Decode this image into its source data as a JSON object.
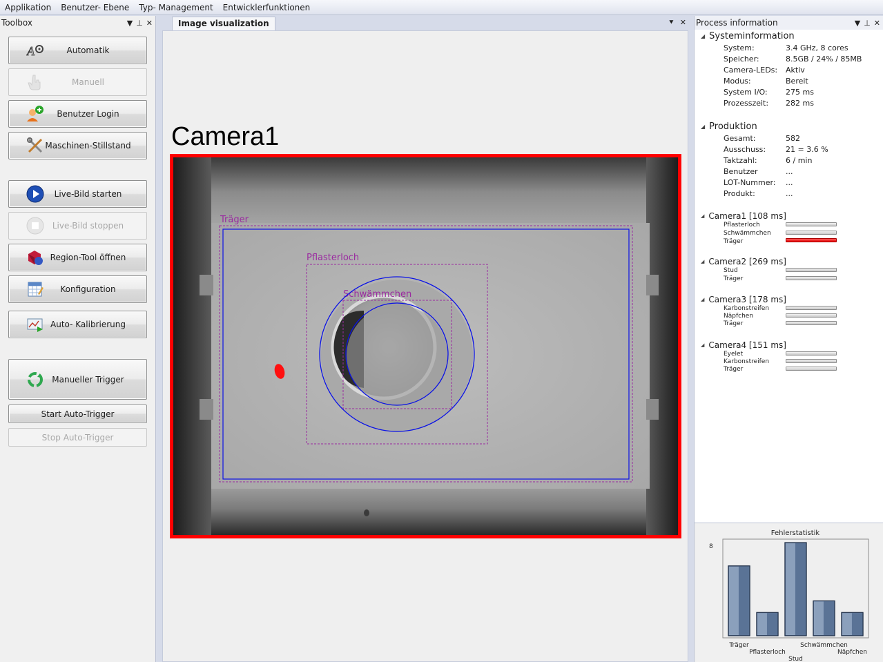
{
  "menu": [
    "Applikation",
    "Benutzer- Ebene",
    "Typ- Management",
    "Entwicklerfunktionen"
  ],
  "toolbox": {
    "title": "Toolbox",
    "buttons": [
      {
        "label": "Automatik",
        "icon": "automatic-icon",
        "enabled": true
      },
      {
        "label": "Manuell",
        "icon": "hand-icon",
        "enabled": false
      },
      {
        "label": "Benutzer Login",
        "icon": "user-add-icon",
        "enabled": true
      },
      {
        "label": "Maschinen-Stillstand",
        "icon": "tools-icon",
        "enabled": true
      },
      {
        "label": "Live-Bild starten",
        "icon": "play-icon",
        "enabled": true
      },
      {
        "label": "Live-Bild stoppen",
        "icon": "stop-icon",
        "enabled": false
      },
      {
        "label": "Region-Tool öffnen",
        "icon": "shapes-icon",
        "enabled": true
      },
      {
        "label": "Konfiguration",
        "icon": "configuration-icon",
        "enabled": true
      },
      {
        "label": "Auto- Kalibrierung",
        "icon": "calibration-icon",
        "enabled": true
      },
      {
        "label": "Manueller Trigger",
        "icon": "refresh-icon",
        "enabled": true
      },
      {
        "label": "Start Auto-Trigger",
        "icon": "",
        "enabled": true
      },
      {
        "label": "Stop Auto-Trigger",
        "icon": "",
        "enabled": false
      }
    ]
  },
  "document": {
    "tab": "Image visualization",
    "camera_title": "Camera1",
    "regions": [
      "Träger",
      "Pflasterloch",
      "Schwämmchen"
    ],
    "status_color": "#ff0000"
  },
  "process": {
    "title": "Process information",
    "system": {
      "title": "Systeminformation",
      "rows": [
        {
          "k": "System:",
          "v": "3.4 GHz, 8 cores"
        },
        {
          "k": "Speicher:",
          "v": "8.5GB / 24% / 85MB"
        },
        {
          "k": "Camera-LEDs:",
          "v": "Aktiv"
        },
        {
          "k": "Modus:",
          "v": "Bereit"
        },
        {
          "k": "System I/O:",
          "v": "275 ms"
        },
        {
          "k": "Prozesszeit:",
          "v": "282 ms"
        }
      ]
    },
    "production": {
      "title": "Produktion",
      "rows": [
        {
          "k": "Gesamt:",
          "v": "582"
        },
        {
          "k": "Ausschuss:",
          "v": "21 = 3.6 %"
        },
        {
          "k": "Taktzahl:",
          "v": "6 / min"
        },
        {
          "k": "Benutzer",
          "v": "..."
        },
        {
          "k": "LOT-Nummer:",
          "v": "..."
        },
        {
          "k": "Produkt:",
          "v": "..."
        }
      ]
    },
    "cameras": [
      {
        "title": "Camera1 [108 ms]",
        "items": [
          {
            "n": "Pflasterloch",
            "fail": false
          },
          {
            "n": "Schwämmchen",
            "fail": false
          },
          {
            "n": "Träger",
            "fail": true
          }
        ]
      },
      {
        "title": "Camera2 [269 ms]",
        "items": [
          {
            "n": "Stud",
            "fail": false
          },
          {
            "n": "Träger",
            "fail": false
          }
        ]
      },
      {
        "title": "Camera3 [178 ms]",
        "items": [
          {
            "n": "Karbonstreifen",
            "fail": false
          },
          {
            "n": "Näpfchen",
            "fail": false
          },
          {
            "n": "Träger",
            "fail": false
          }
        ]
      },
      {
        "title": "Camera4 [151 ms]",
        "items": [
          {
            "n": "Eyelet",
            "fail": false
          },
          {
            "n": "Karbonstreifen",
            "fail": false
          },
          {
            "n": "Träger",
            "fail": false
          }
        ]
      }
    ]
  },
  "chart_data": {
    "type": "bar",
    "title": "Fehlerstatistik",
    "categories": [
      "Träger",
      "Pflasterloch",
      "Stud",
      "Schwämmchen",
      "Näpfchen"
    ],
    "values": [
      6,
      2,
      8,
      3,
      2
    ],
    "ytick_labels": [
      "8"
    ],
    "ylim": [
      0,
      8
    ],
    "grid": false,
    "bar_color": "#5a7396"
  }
}
